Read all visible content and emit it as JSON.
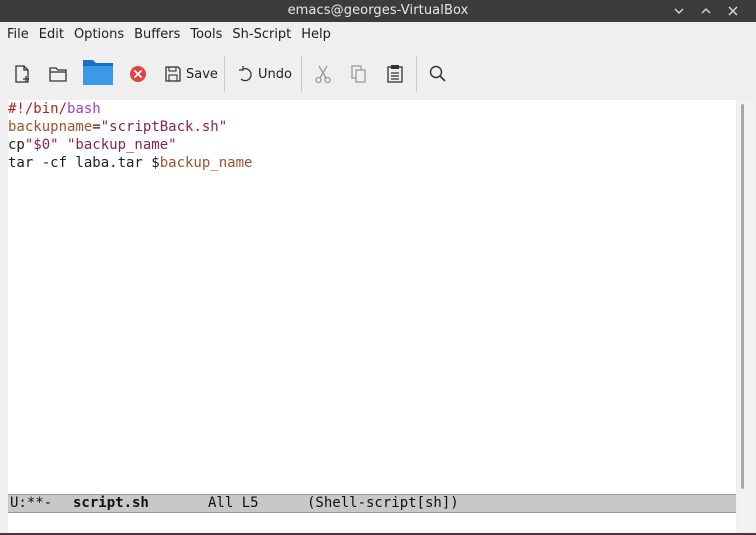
{
  "window": {
    "title": "emacs@georges-VirtualBox"
  },
  "menu": [
    "File",
    "Edit",
    "Options",
    "Buffers",
    "Tools",
    "Sh-Script",
    "Help"
  ],
  "toolbar": {
    "save_label": "Save",
    "undo_label": "Undo"
  },
  "buffer": {
    "lines": [
      [
        {
          "t": "#!",
          "c": "comment"
        },
        {
          "t": "/bin/",
          "c": "comment"
        },
        {
          "t": "bash",
          "c": "kw"
        }
      ],
      [
        {
          "t": "backupname",
          "c": "var"
        },
        {
          "t": "=",
          "c": ""
        },
        {
          "t": "\"scriptBack.sh\"",
          "c": "str"
        }
      ],
      [
        {
          "t": "cp",
          "c": ""
        },
        {
          "t": "\"$0\" \"backup_name\"",
          "c": "str"
        }
      ],
      [
        {
          "t": "tar -cf laba.tar $",
          "c": ""
        },
        {
          "t": "backup_name",
          "c": "var"
        }
      ]
    ]
  },
  "modeline": {
    "status": "U:**-",
    "buffer_name": "script.sh",
    "position": "All L5",
    "mode": "(Shell-script[sh])"
  }
}
